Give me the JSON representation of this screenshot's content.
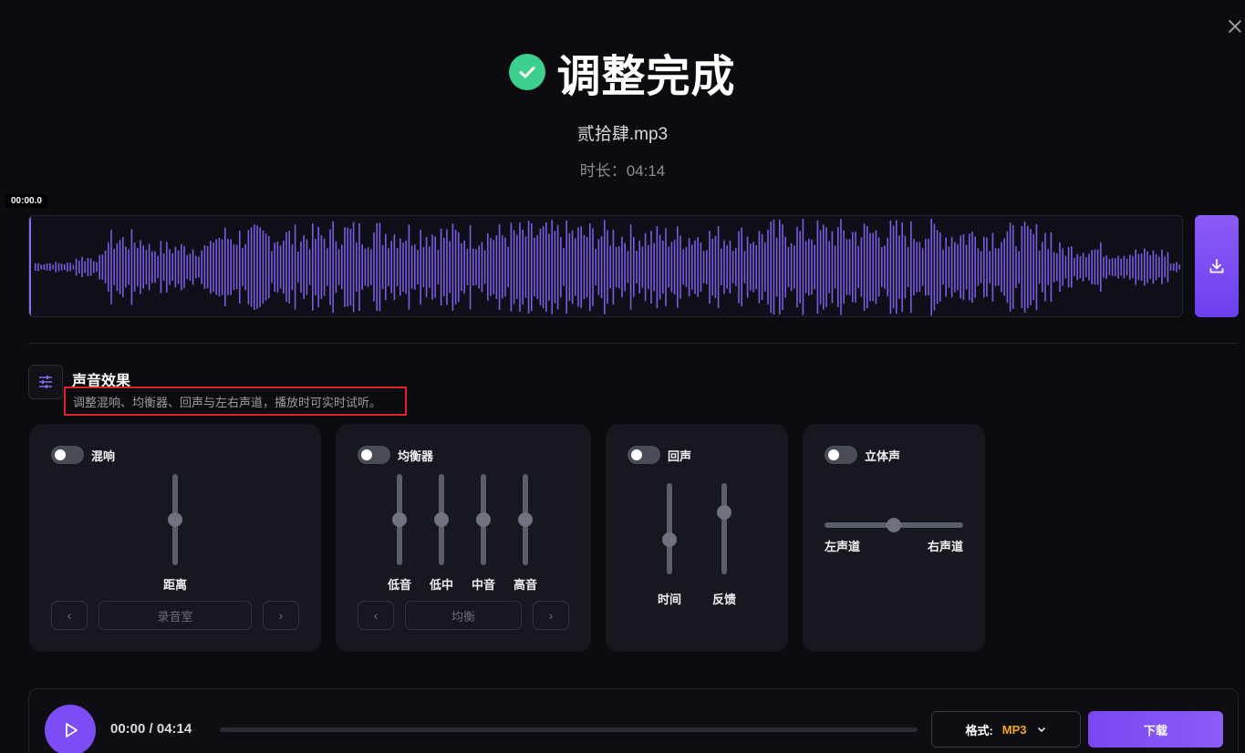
{
  "header": {
    "title": "调整完成",
    "file_name": "贰拾肆.mp3",
    "duration": "时长：04:14"
  },
  "waveform": {
    "time_tip": "00:00.0",
    "color": "#7b5be0"
  },
  "effects": {
    "title": "声音效果",
    "description": "调整混响、均衡器、回声与左右声道，播放时可实时试听。",
    "reverb": {
      "label": "混响",
      "slider_label": "距离",
      "preset": "录音室",
      "prev": "‹",
      "next": "›",
      "level": 0.5
    },
    "equalizer": {
      "label": "均衡器",
      "bands": [
        {
          "label": "低音",
          "level": 0.5
        },
        {
          "label": "低中",
          "level": 0.5
        },
        {
          "label": "中音",
          "level": 0.5
        },
        {
          "label": "高音",
          "level": 0.5
        }
      ],
      "preset": "均衡",
      "prev": "‹",
      "next": "›"
    },
    "echo": {
      "label": "回声",
      "time_label": "时间",
      "feedback_label": "反馈",
      "time_level": 0.38,
      "feedback_level": 0.68
    },
    "stereo": {
      "label": "立体声",
      "left_label": "左声道",
      "right_label": "右声道",
      "balance": 0.5
    }
  },
  "player": {
    "time": "00:00 / 04:14",
    "format_label": "格式:",
    "format_value": "MP3",
    "download_label": "下载",
    "progress": 0
  },
  "colors": {
    "accent": "#7c4cf4",
    "success": "#3ccf8e",
    "format": "#f5a623",
    "highlight_border": "#e0222a"
  }
}
